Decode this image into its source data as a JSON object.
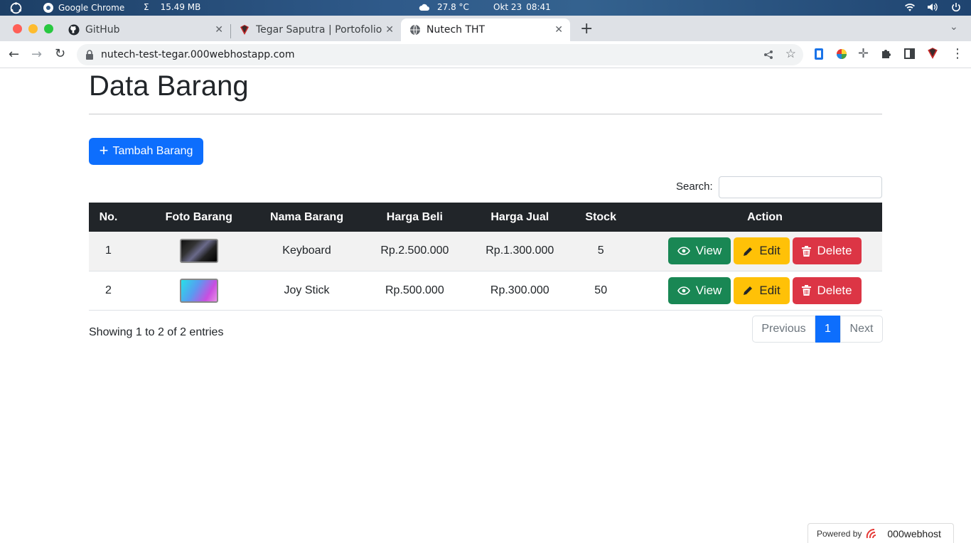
{
  "os": {
    "app_name": "Google Chrome",
    "memory": "15.49 MB",
    "weather": "27.8 °C",
    "date": "Okt 23",
    "time": "08:41"
  },
  "browser": {
    "tabs": [
      {
        "label": "GitHub"
      },
      {
        "label": "Tegar Saputra | Portofolio"
      },
      {
        "label": "Nutech THT"
      }
    ],
    "url": "nutech-test-tegar.000webhostapp.com"
  },
  "page": {
    "title": "Data Barang",
    "add_button": "Tambah Barang",
    "search_label": "Search:",
    "search_value": "",
    "table": {
      "headers": [
        "No.",
        "Foto Barang",
        "Nama Barang",
        "Harga Beli",
        "Harga Jual",
        "Stock",
        "Action"
      ],
      "rows": [
        {
          "no": "1",
          "nama": "Keyboard",
          "beli": "Rp.2.500.000",
          "jual": "Rp.1.300.000",
          "stock": "5"
        },
        {
          "no": "2",
          "nama": "Joy Stick",
          "beli": "Rp.500.000",
          "jual": "Rp.300.000",
          "stock": "50"
        }
      ],
      "actions": {
        "view": "View",
        "edit": "Edit",
        "delete": "Delete"
      }
    },
    "info": "Showing 1 to 2 of 2 entries",
    "pagination": {
      "previous": "Previous",
      "current": "1",
      "next": "Next"
    },
    "powered": {
      "prefix": "Powered by",
      "brand": "000webhost"
    }
  }
}
